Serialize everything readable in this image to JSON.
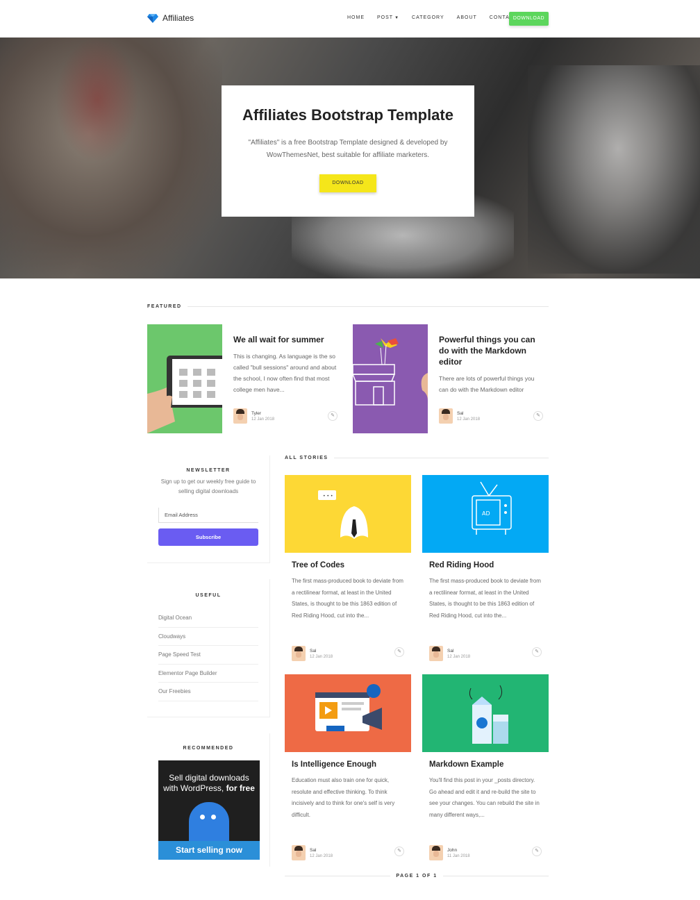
{
  "nav": {
    "brand": "Affiliates",
    "menu": [
      "HOME",
      "POST",
      "CATEGORY",
      "ABOUT",
      "CONTACT"
    ],
    "download": "DOWNLOAD"
  },
  "hero": {
    "title": "Affiliates Bootstrap Template",
    "text": "\"Affiliates\" is a free Bootstrap Template designed & developed by WowThemesNet, best suitable for affiliate marketers.",
    "button": "DOWNLOAD"
  },
  "featured": {
    "heading": "FEATURED",
    "items": [
      {
        "title": "We all wait for summer",
        "excerpt": "This is changing. As language is the so called \"bull sessions\" around and about the school, I now often find that most college men have...",
        "author": "Tyler",
        "date": "12 Jan 2018"
      },
      {
        "title": "Powerful things you can do with the Markdown editor",
        "excerpt": "There are lots of powerful things you can do with the Markdown editor",
        "author": "Sal",
        "date": "12 Jan 2018"
      }
    ]
  },
  "sidebar": {
    "newsletter": {
      "title": "NEWSLETTER",
      "text": "Sign up to get our weekly free guide to selling digital downloads",
      "placeholder": "Email Address",
      "button": "Subscribe"
    },
    "useful": {
      "title": "USEFUL",
      "links": [
        "Digital Ocean",
        "Cloudways",
        "Page Speed Test",
        "Elementor Page Builder",
        "Our Freebies"
      ]
    },
    "recommended": {
      "title": "RECOMMENDED",
      "banner_line1": "Sell digital downloads",
      "banner_line2": "with WordPress,",
      "banner_bold": "for free",
      "banner_cta": "Start selling now"
    }
  },
  "stories": {
    "heading": "ALL STORIES",
    "items": [
      {
        "title": "Tree of Codes",
        "excerpt": "The first mass-produced book to deviate from a rectilinear format, at least in the United States, is thought to be this 1863 edition of Red Riding Hood, cut into the...",
        "author": "Sal",
        "date": "12 Jan 2018"
      },
      {
        "title": "Red Riding Hood",
        "excerpt": "The first mass-produced book to deviate from a rectilinear format, at least in the United States, is thought to be this 1863 edition of Red Riding Hood, cut into the...",
        "author": "Sal",
        "date": "12 Jan 2018"
      },
      {
        "title": "Is Intelligence Enough",
        "excerpt": "Education must also train one for quick, resolute and effective thinking. To think incisively and to think for one's self is very difficult.",
        "author": "Sal",
        "date": "12 Jan 2018"
      },
      {
        "title": "Markdown Example",
        "excerpt": "You'll find this post in your _posts directory. Go ahead and edit it and re-build the site to see your changes. You can rebuild the site in many different ways,...",
        "author": "John",
        "date": "11 Jan 2018"
      }
    ],
    "pager": "PAGE 1 OF 1"
  },
  "colors": {
    "nav_button": "#5cd65c",
    "hero_button": "#f5e61a",
    "subscribe": "#6a5cf2",
    "yellow_tile": "#fdd835",
    "blue_tile": "#03a9f4",
    "orange_tile": "#ee6a45",
    "green_tile": "#22b573",
    "featured_green": "#6cc76c",
    "featured_purple": "#8a5ab0"
  }
}
